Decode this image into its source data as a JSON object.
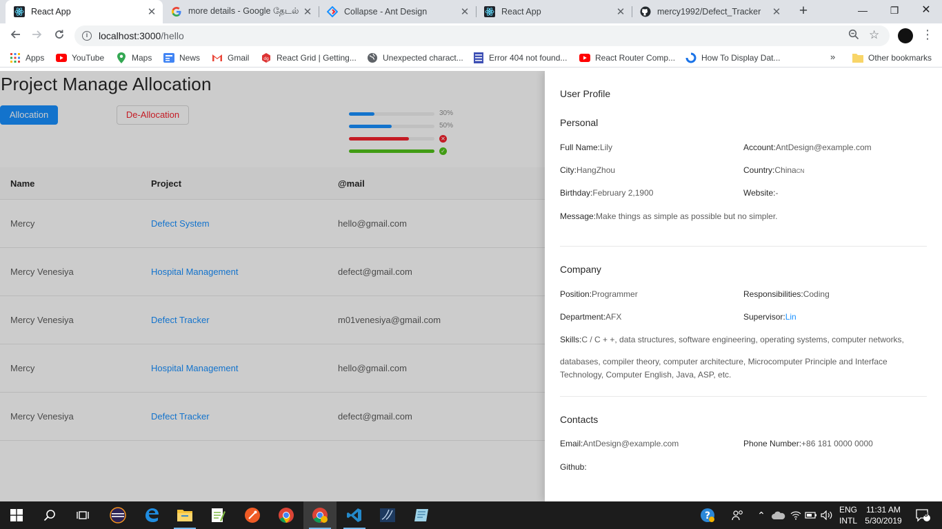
{
  "browser": {
    "tabs": [
      {
        "title": "React App",
        "icon": "react-icon"
      },
      {
        "title": "more details - Google தேடல்",
        "icon": "google-icon"
      },
      {
        "title": "Collapse - Ant Design",
        "icon": "ant-design-icon"
      },
      {
        "title": "React App",
        "icon": "react-icon"
      },
      {
        "title": "mercy1992/Defect_Tracker",
        "icon": "github-icon"
      }
    ],
    "url_host": "localhost:3000",
    "url_path": "/hello",
    "bookmarks": [
      "Apps",
      "YouTube",
      "Maps",
      "News",
      "Gmail",
      "React Grid | Getting...",
      "Unexpected charact...",
      "Error 404 not found...",
      "React Router Comp...",
      "How To Display Dat..."
    ],
    "bookmarks_more": "»",
    "other_bookmarks": "Other bookmarks"
  },
  "page": {
    "title": "Project Manage Allocation",
    "allocation_button": "Allocation",
    "deallocation_button": "De-Allocation",
    "progress": [
      {
        "percent": 30,
        "status": "active",
        "label": "30%"
      },
      {
        "percent": 50,
        "status": "active",
        "label": "50%"
      },
      {
        "percent": 70,
        "status": "exception",
        "label": "✕"
      },
      {
        "percent": 100,
        "status": "success",
        "label": "✓"
      }
    ],
    "colors": {
      "primary": "#1890ff",
      "exception": "#f5222d",
      "success": "#52c41a"
    },
    "table": {
      "columns": [
        "Name",
        "Project",
        "@mail"
      ],
      "rows": [
        {
          "name": "Mercy",
          "project": "Defect System",
          "mail": "hello@gmail.com"
        },
        {
          "name": "Mercy Venesiya",
          "project": "Hospital Management",
          "mail": "defect@gmail.com"
        },
        {
          "name": "Mercy Venesiya",
          "project": "Defect Tracker",
          "mail": "m01venesiya@gmail.com"
        },
        {
          "name": "Mercy",
          "project": "Hospital Management",
          "mail": "hello@gmail.com"
        },
        {
          "name": "Mercy Venesiya",
          "project": "Defect Tracker",
          "mail": "defect@gmail.com"
        }
      ]
    }
  },
  "drawer": {
    "title": "User Profile",
    "personal": {
      "heading": "Personal",
      "full_name_label": "Full Name:",
      "full_name": "Lily",
      "account_label": "Account:",
      "account": "AntDesign@example.com",
      "city_label": "City:",
      "city": "HangZhou",
      "country_label": "Country:",
      "country": "China",
      "country_code": "CN",
      "birthday_label": "Birthday:",
      "birthday": "February 2,1900",
      "website_label": "Website:",
      "website": "-",
      "message_label": "Message:",
      "message": "Make things as simple as possible but no simpler."
    },
    "company": {
      "heading": "Company",
      "position_label": "Position:",
      "position": "Programmer",
      "responsibilities_label": "Responsibilities:",
      "responsibilities": "Coding",
      "department_label": "Department:",
      "department": "AFX",
      "supervisor_label": "Supervisor:",
      "supervisor": "Lin",
      "skills_label": "Skills:",
      "skills_line1": "C / C + +, data structures, software engineering, operating systems, computer networks,",
      "skills_line2": "databases, compiler theory, computer architecture, Microcomputer Principle and Interface",
      "skills_line3": "Technology, Computer English, Java, ASP, etc."
    },
    "contacts": {
      "heading": "Contacts",
      "email_label": "Email:",
      "email": "AntDesign@example.com",
      "phone_label": "Phone Number:",
      "phone": "+86 181 0000 0000",
      "github_label": "Github:"
    }
  },
  "taskbar": {
    "language": "ENG",
    "layout": "INTL",
    "time": "11:31 AM",
    "date": "5/30/2019",
    "notification_count": "3"
  }
}
